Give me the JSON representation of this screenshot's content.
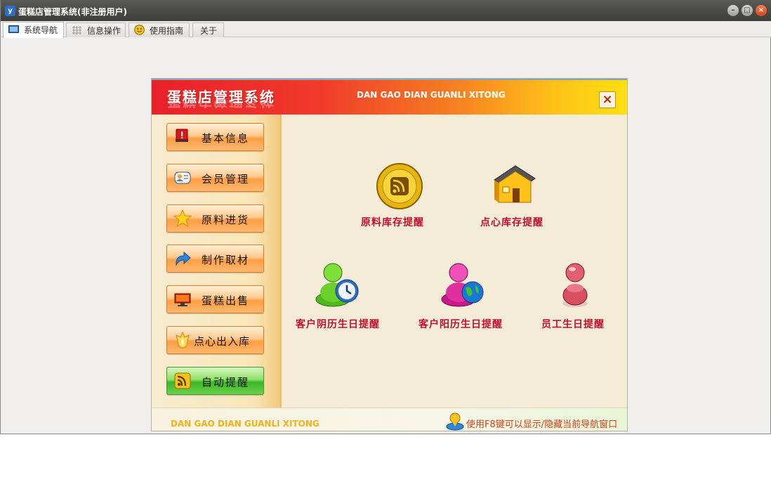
{
  "window": {
    "title": "蛋糕店管理系统(非注册用户)",
    "app_icon": "y"
  },
  "tabs": [
    {
      "label": "系统导航",
      "icon": "monitor-icon"
    },
    {
      "label": "信息操作",
      "icon": "grid-icon"
    },
    {
      "label": "使用指南",
      "icon": "smiley-icon"
    },
    {
      "label": "关于",
      "icon": ""
    }
  ],
  "panel": {
    "title": "蛋糕店管理系统",
    "subtitle": "DAN GAO DIAN GUANLI XITONG",
    "footer_left": "DAN GAO DIAN GUANLI XITONG",
    "footer_hint": "使用F8键可以显示/隐藏当前导航窗口"
  },
  "sidebar": {
    "items": [
      {
        "label": "基本信息",
        "icon": "alert-monitor-icon"
      },
      {
        "label": "会员管理",
        "icon": "contact-card-icon"
      },
      {
        "label": "原料进货",
        "icon": "star-icon"
      },
      {
        "label": "制作取材",
        "icon": "arrow-icon"
      },
      {
        "label": "蛋糕出售",
        "icon": "display-icon"
      },
      {
        "label": "点心出入库",
        "icon": "flame-icon"
      },
      {
        "label": "自动提醒",
        "icon": "rss-icon"
      }
    ]
  },
  "content": {
    "items": [
      {
        "label": "原料库存提醒",
        "icon": "rss-gold-icon"
      },
      {
        "label": "点心库存提醒",
        "icon": "house-icon"
      },
      {
        "label": "客户阴历生日提醒",
        "icon": "user-clock-icon"
      },
      {
        "label": "客户阳历生日提醒",
        "icon": "user-globe-icon"
      },
      {
        "label": "员工生日提醒",
        "icon": "user-icon"
      }
    ]
  },
  "colors": {
    "header_start": "#e8202a",
    "header_end": "#ffe010",
    "label_red": "#c0102e",
    "sidebar_button": "#ff9e45",
    "active_button": "#3cb52b"
  }
}
